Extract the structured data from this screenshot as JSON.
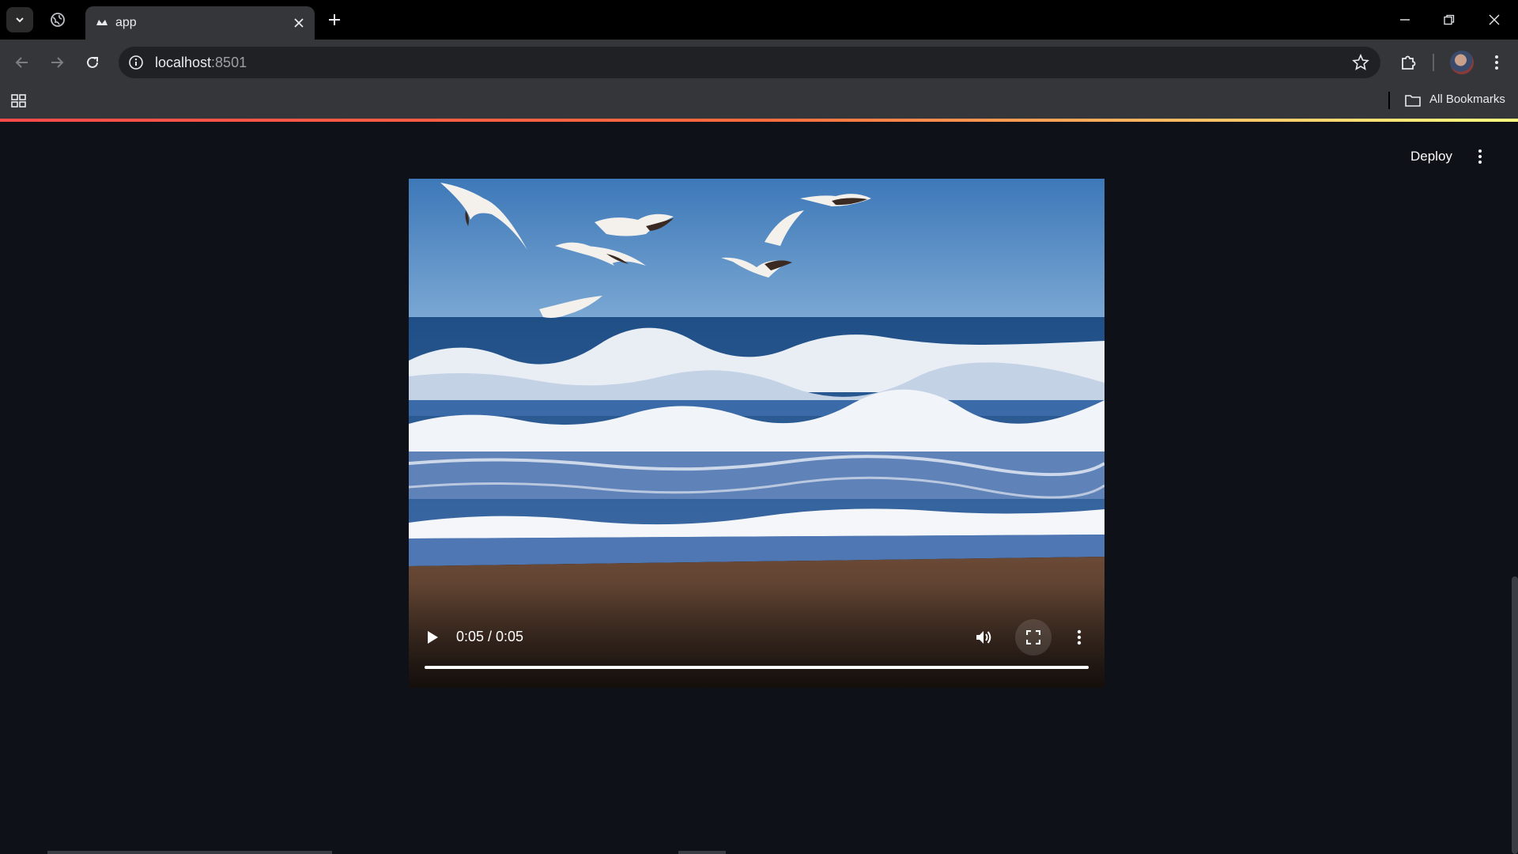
{
  "browser": {
    "tab_title": "app",
    "url_host": "localhost",
    "url_port": ":8501",
    "bookmarks_label": "All Bookmarks"
  },
  "app": {
    "deploy_label": "Deploy"
  },
  "video": {
    "time_display": "0:05 / 0:05",
    "progress_fraction": 1.0
  },
  "colors": {
    "page_background": "#0e1117",
    "decoration_start": "#ff4b4b",
    "decoration_end": "#fffd80"
  }
}
